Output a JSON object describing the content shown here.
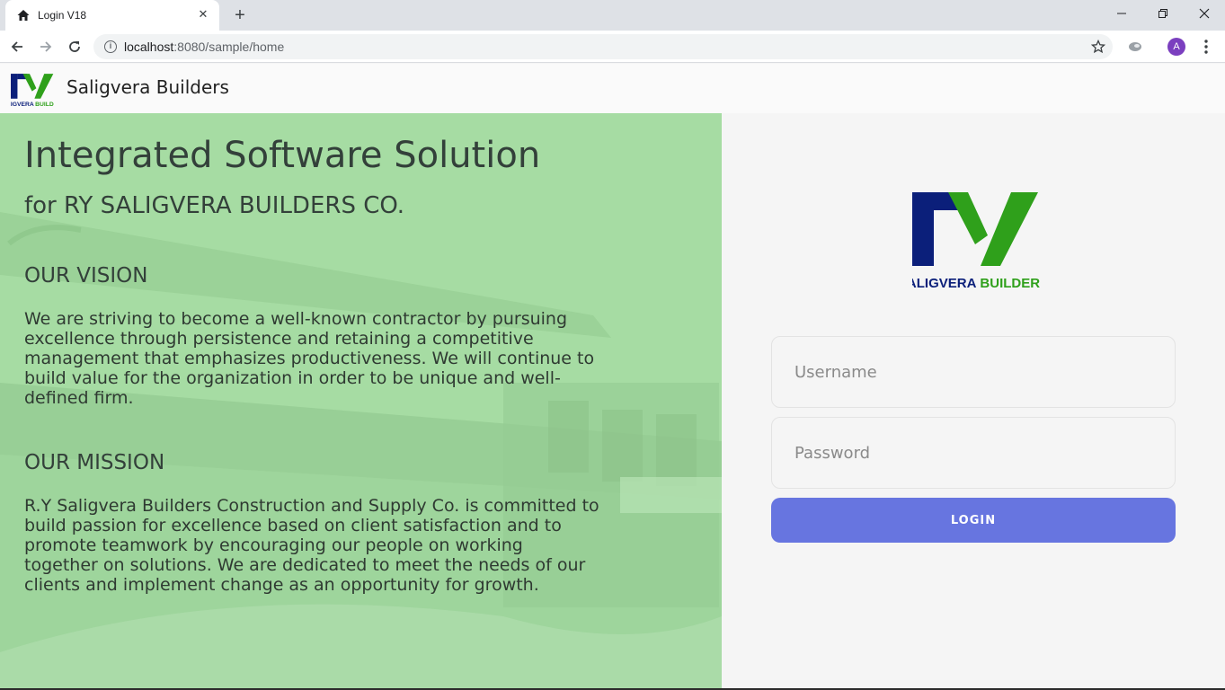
{
  "browser": {
    "tab_title": "Login V18",
    "tab_close": "✕",
    "new_tab": "+",
    "url_host": "localhost",
    "url_path": ":8080/sample/home",
    "avatar_letter": "A",
    "info_glyph": "i",
    "icons": [
      "home-icon",
      "close-icon",
      "back-arrow-icon",
      "forward-arrow-icon",
      "reload-icon",
      "info-icon",
      "star-icon",
      "extension-icon",
      "kebab-menu-icon",
      "minimize-icon",
      "restore-icon",
      "window-close-icon"
    ]
  },
  "header": {
    "brand": "Saligvera Builders"
  },
  "hero": {
    "title": "Integrated Software Solution",
    "subtitle": "for RY SALIGVERA BUILDERS CO.",
    "vision_heading": "OUR VISION",
    "vision_text": "We are striving to become a well-known contractor by pursuing excellence through persistence and retaining a competitive management that emphasizes productiveness. We will continue to build value for the organization in order to be unique and well-defined firm.",
    "mission_heading": "OUR MISSION",
    "mission_text": "R.Y Saligvera Builders Construction and Supply Co. is committed to build passion for excellence based on client satisfaction and to promote teamwork by encouraging our people on working together on solutions. We are dedicated to meet the needs of our clients and implement change as an opportunity for growth."
  },
  "logo": {
    "caption": "SALIGVERA BUILDERS",
    "caption_word1": "SALIGVERA",
    "caption_word2": "BUILDERS",
    "navy": "#0b1f7a",
    "green": "#2fa01b"
  },
  "login": {
    "username_placeholder": "Username",
    "password_placeholder": "Password",
    "button_label": "LOGIN",
    "accent": "#6775e0"
  }
}
